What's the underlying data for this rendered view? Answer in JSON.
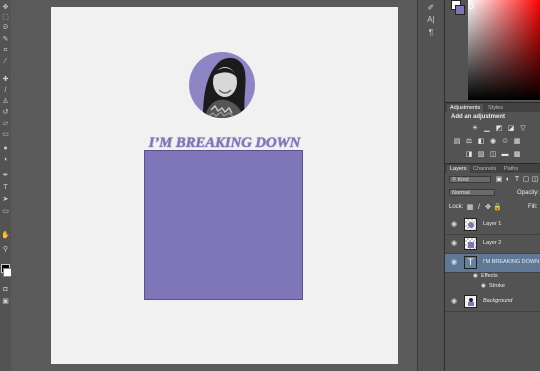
{
  "canvas": {
    "headline": "I’M BREAKING DOWN"
  },
  "toolbar": {
    "tools": [
      "move-tool",
      "marquee-tool",
      "lasso-tool",
      "quick-select-tool",
      "crop-tool",
      "eyedropper-tool",
      "healing-tool",
      "brush-tool",
      "stamp-tool",
      "history-brush-tool",
      "eraser-tool",
      "gradient-tool",
      "blur-tool",
      "dodge-tool",
      "pen-tool",
      "type-tool",
      "path-select-tool",
      "shape-tool",
      "hand-tool",
      "zoom-tool"
    ]
  },
  "gutter": {
    "icons": [
      "history-icon",
      "character-icon",
      "paragraph-icon"
    ]
  },
  "adjustments": {
    "tabs": [
      "Adjustments",
      "Styles"
    ],
    "heading": "Add an adjustment"
  },
  "layers_panel": {
    "tabs": [
      "Layers",
      "Channels",
      "Paths"
    ],
    "filter_kind": "Kind",
    "blend_mode": "Normal",
    "opacity_label": "Opacity:",
    "lock_label": "Lock:",
    "fill_label": "Fill:",
    "layers": [
      {
        "name": "Layer 1",
        "thumb": "checker"
      },
      {
        "name": "Layer 2",
        "thumb": "checker"
      },
      {
        "name": "I'M BREAKING DOWN",
        "thumb": "type"
      },
      {
        "name": "Background",
        "thumb": "image"
      }
    ],
    "effects_label": "Effects",
    "stroke_label": "Stroke"
  },
  "colors": {
    "accent_purple": "#7e76b8",
    "selection_blue": "#5e7896"
  }
}
